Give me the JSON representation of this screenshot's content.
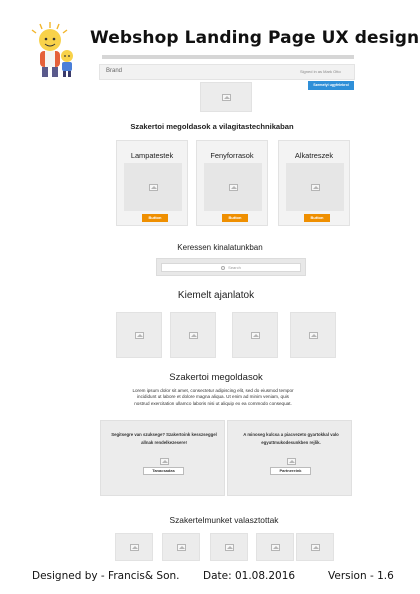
{
  "doc": {
    "title": "Webshop Landing Page UX design",
    "mascot_icon": "lightbulb-family-illustration"
  },
  "navbar": {
    "brand": "Brand",
    "signed_in": "Signed in as Mark Otto",
    "signup_button": "Szemelyi ugyfelekrol",
    "accent": "#2f8fd8"
  },
  "hero": {
    "image_icon": "image-placeholder-icon"
  },
  "solutions_heading": "Szakertoi megoldasok a vilagitastechnikaban",
  "categories": [
    {
      "title": "Lampatestek",
      "button": "Button"
    },
    {
      "title": "Fenyforrasok",
      "button": "Button"
    },
    {
      "title": "Alkatreszek",
      "button": "Button"
    }
  ],
  "button_color": "#ef8f00",
  "search": {
    "heading": "Keressen kinalatunkban",
    "placeholder": "Search"
  },
  "offers": {
    "heading": "Kiemelt ajanlatok",
    "count_items": [
      "",
      "",
      "",
      ""
    ]
  },
  "expert": {
    "heading": "Szakertoi megoldasok",
    "body": "Lorem ipsum dolor sit amet, consectetur adipiscing elit, sed do eiusmod tempor incididunt ut labore et dolore magna aliqua. Ut enim ad minim veniam, quis nostrud exercitation ullamco laboris nisi ut aliquip ex ea commodo consequat.",
    "panels": [
      {
        "text": "Segitsegre van szuksege? Szakertoink kesszseggel allnak rendelkezesere!",
        "button": "Tanacsadas"
      },
      {
        "text": "A minoseg kulcsa a piacvezeto gyartokkal valo egyuttmukodesunkben rejlik.",
        "button": "Partnereink"
      }
    ]
  },
  "picks": {
    "heading": "Szakertelmunket valasztottak"
  },
  "footer": {
    "designer": "Designed by - Francis& Son.",
    "date": "Date: 01.08.2016",
    "version": "Version - 1.6"
  }
}
